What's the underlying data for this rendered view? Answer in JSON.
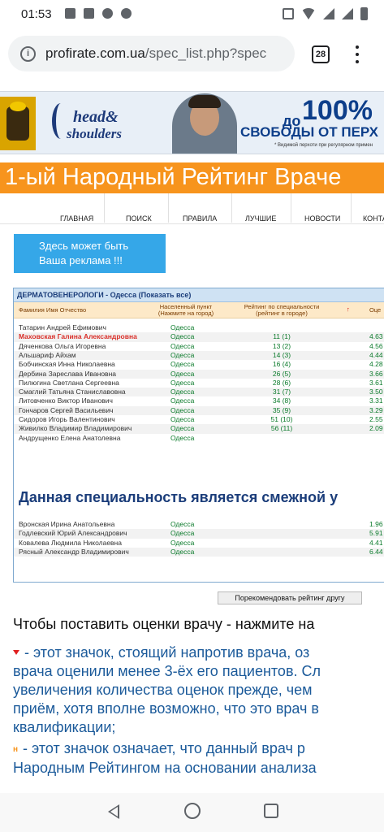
{
  "status": {
    "time": "01:53"
  },
  "browser": {
    "url_domain": "profirate.com.ua",
    "url_path": "/spec_list.php?spec",
    "tab_count": "28"
  },
  "ad_banner": {
    "brand_line1": "head&",
    "brand_line2": "shoulders",
    "prefix": "до",
    "percent": "100%",
    "tagline": "СВОБОДЫ ОТ ПЕРХ",
    "note": "* Видимой перхоти при регулярном примен"
  },
  "site_title": "1-ый Народный Рейтинг Враче",
  "nav": [
    "ГЛАВНАЯ",
    "ПОИСК",
    "ПРАВИЛА",
    "ЛУЧШИЕ",
    "НОВОСТИ",
    "КОНТА"
  ],
  "ad_box": {
    "line1": "Здесь может быть",
    "line2": "Ваша реклама !!!"
  },
  "table": {
    "header": "ДЕРМАТОВЕНЕРОЛОГИ - Одесса (Показать все)",
    "col_name": "Фамилия Имя Отчество",
    "col_city_1": "Населенный пункт",
    "col_city_2": "(Нажмите на город)",
    "col_rank_1": "Рейтинг по специальности",
    "col_rank_2": "(рейтинг в городе)",
    "col_arrow": "↑",
    "col_score": "Оце",
    "rows": [
      {
        "name": "Татарин Андрей Ефимович",
        "city": "Одесса",
        "rank": "",
        "score": ""
      },
      {
        "name": "Маховская Галина Александровна",
        "city": "Одесса",
        "rank": "11 (1)",
        "score": "4.63"
      },
      {
        "name": "Дяченкова Ольга Игоревна",
        "city": "Одесса",
        "rank": "13 (2)",
        "score": "4.56"
      },
      {
        "name": "Альшариф Айхам",
        "city": "Одесса",
        "rank": "14 (3)",
        "score": "4.44"
      },
      {
        "name": "Бобчинская Инна Николаевна",
        "city": "Одесса",
        "rank": "16 (4)",
        "score": "4.28"
      },
      {
        "name": "Дербина Зарeслава Ивановна",
        "city": "Одесса",
        "rank": "26 (5)",
        "score": "3.66"
      },
      {
        "name": "Пилюгина Светлана Сергеевна",
        "city": "Одесса",
        "rank": "28 (6)",
        "score": "3.61"
      },
      {
        "name": "Смаглий Татьяна Станиславовна",
        "city": "Одесса",
        "rank": "31 (7)",
        "score": "3.50"
      },
      {
        "name": "Литовченко Виктор Иванович",
        "city": "Одесса",
        "rank": "34 (8)",
        "score": "3.31"
      },
      {
        "name": "Гончаров Сергей Васильевич",
        "city": "Одесса",
        "rank": "35 (9)",
        "score": "3.29"
      },
      {
        "name": "Сидоров Игорь Валентинович",
        "city": "Одесса",
        "rank": "51 (10)",
        "score": "2.55"
      },
      {
        "name": "Живилко Владимир Владимирович",
        "city": "Одесса",
        "rank": "56 (11)",
        "score": "2.09"
      },
      {
        "name": "Андрущенко Елена Анатолевна",
        "city": "Одесса",
        "rank": "",
        "score": ""
      }
    ],
    "adjacent_heading": "Данная специальность является смежной у",
    "adjacent_rows": [
      {
        "name": "Вронская Ирина Анатольевна",
        "city": "Одесса",
        "score": "1.96"
      },
      {
        "name": "Годлевский Юрий Александрович",
        "city": "Одесса",
        "score": "5.91"
      },
      {
        "name": "Ковалева Людмила Николаевна",
        "city": "Одесса",
        "score": "4.41"
      },
      {
        "name": "Рясный Александр Владимирович",
        "city": "Одесса",
        "score": "6.44"
      }
    ]
  },
  "recommend_button": "Порекомендовать рейтинг другу",
  "text": {
    "main": "Чтобы поставить оценки врачу - нажмите на",
    "red_lines": [
      "-  этот значок, стоящий напротив врача, оз",
      "врача оценили менее 3-ёх его пациентов. Сл",
      "увеличения количества оценок прежде, чем",
      "приём, хотя вполне возможно, что это врач в",
      "квалификации;"
    ],
    "n_badge": "н",
    "n_lines": [
      "-  этот значок означает, что данный врач р",
      "Народным Рейтингом на основании анализа"
    ]
  },
  "colors": {
    "title_bar": "#f7941d",
    "ad_box": "#35a7e8",
    "table_header": "#cfe2f3",
    "highlight_name": "#d9302a",
    "green_values": "#0a7a2a",
    "body_link": "#1b5a9a"
  }
}
